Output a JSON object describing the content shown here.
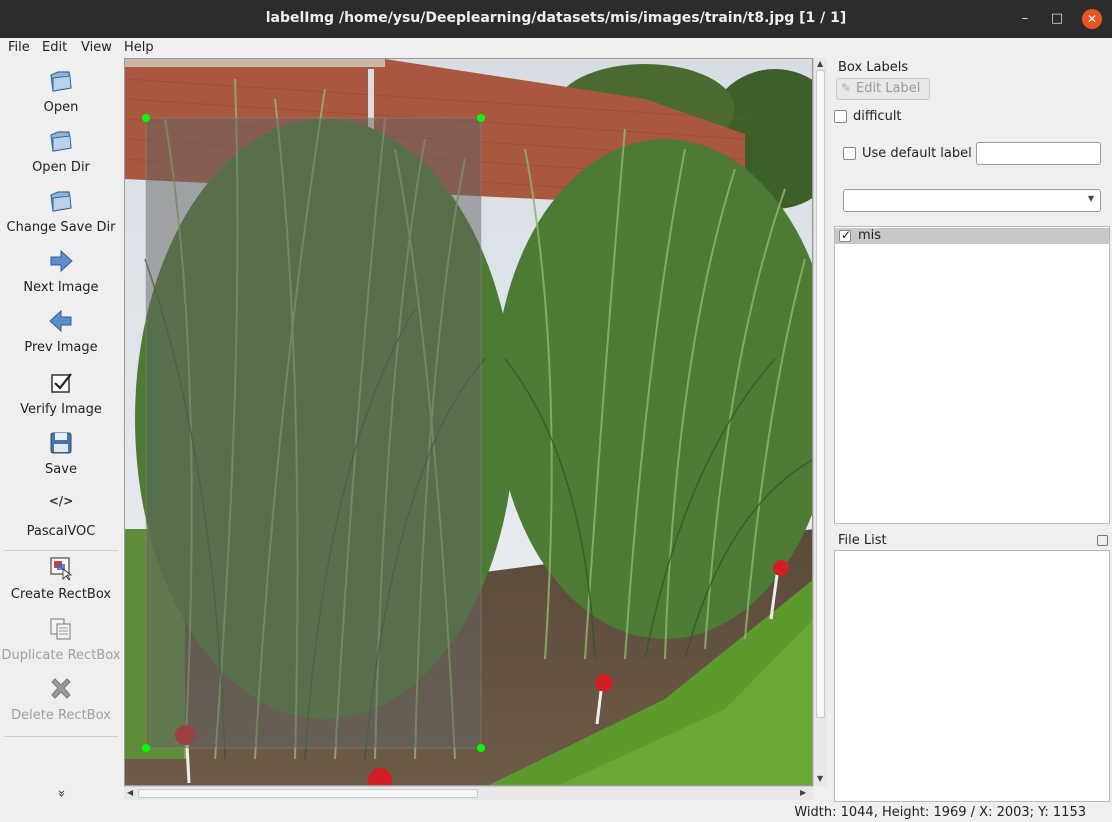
{
  "window": {
    "title": "labelImg /home/ysu/Deeplearning/datasets/mis/images/train/t8.jpg [1 / 1]",
    "controls": {
      "minimize": "–",
      "maximize": "□",
      "close": "✕"
    }
  },
  "menu": [
    "File",
    "Edit",
    "View",
    "Help"
  ],
  "toolbar": {
    "open": "Open",
    "open_dir": "Open Dir",
    "change_save_dir": "Change Save Dir",
    "next_image": "Next Image",
    "prev_image": "Prev Image",
    "verify_image": "Verify Image",
    "save": "Save",
    "format_glyph": "</>",
    "format": "PascalVOC",
    "create_rectbox": "Create RectBox",
    "duplicate_rectbox": "Duplicate RectBox",
    "delete_rectbox": "Delete RectBox",
    "more_glyph": "»"
  },
  "box_labels_panel": {
    "title": "Box Labels",
    "edit_label_button": "Edit Label",
    "difficult": {
      "label": "difficult",
      "checked": false
    },
    "use_default_label": {
      "label": "Use default label",
      "checked": false,
      "value": ""
    },
    "label_combo": {
      "value": ""
    },
    "labels": [
      {
        "name": "mis",
        "checked": true,
        "selected": true
      }
    ]
  },
  "file_list_panel": {
    "title": "File List",
    "files": []
  },
  "status": "Width: 1044, Height: 1969 / X: 2003; Y: 1153",
  "colors": {
    "titlebar": "#2c2c2c",
    "close_button": "#e95420",
    "bounding_box_fill": "rgba(100,100,100,0.5)",
    "vertex_handle": "#00ff00",
    "selected_row": "#c8c8c8"
  }
}
